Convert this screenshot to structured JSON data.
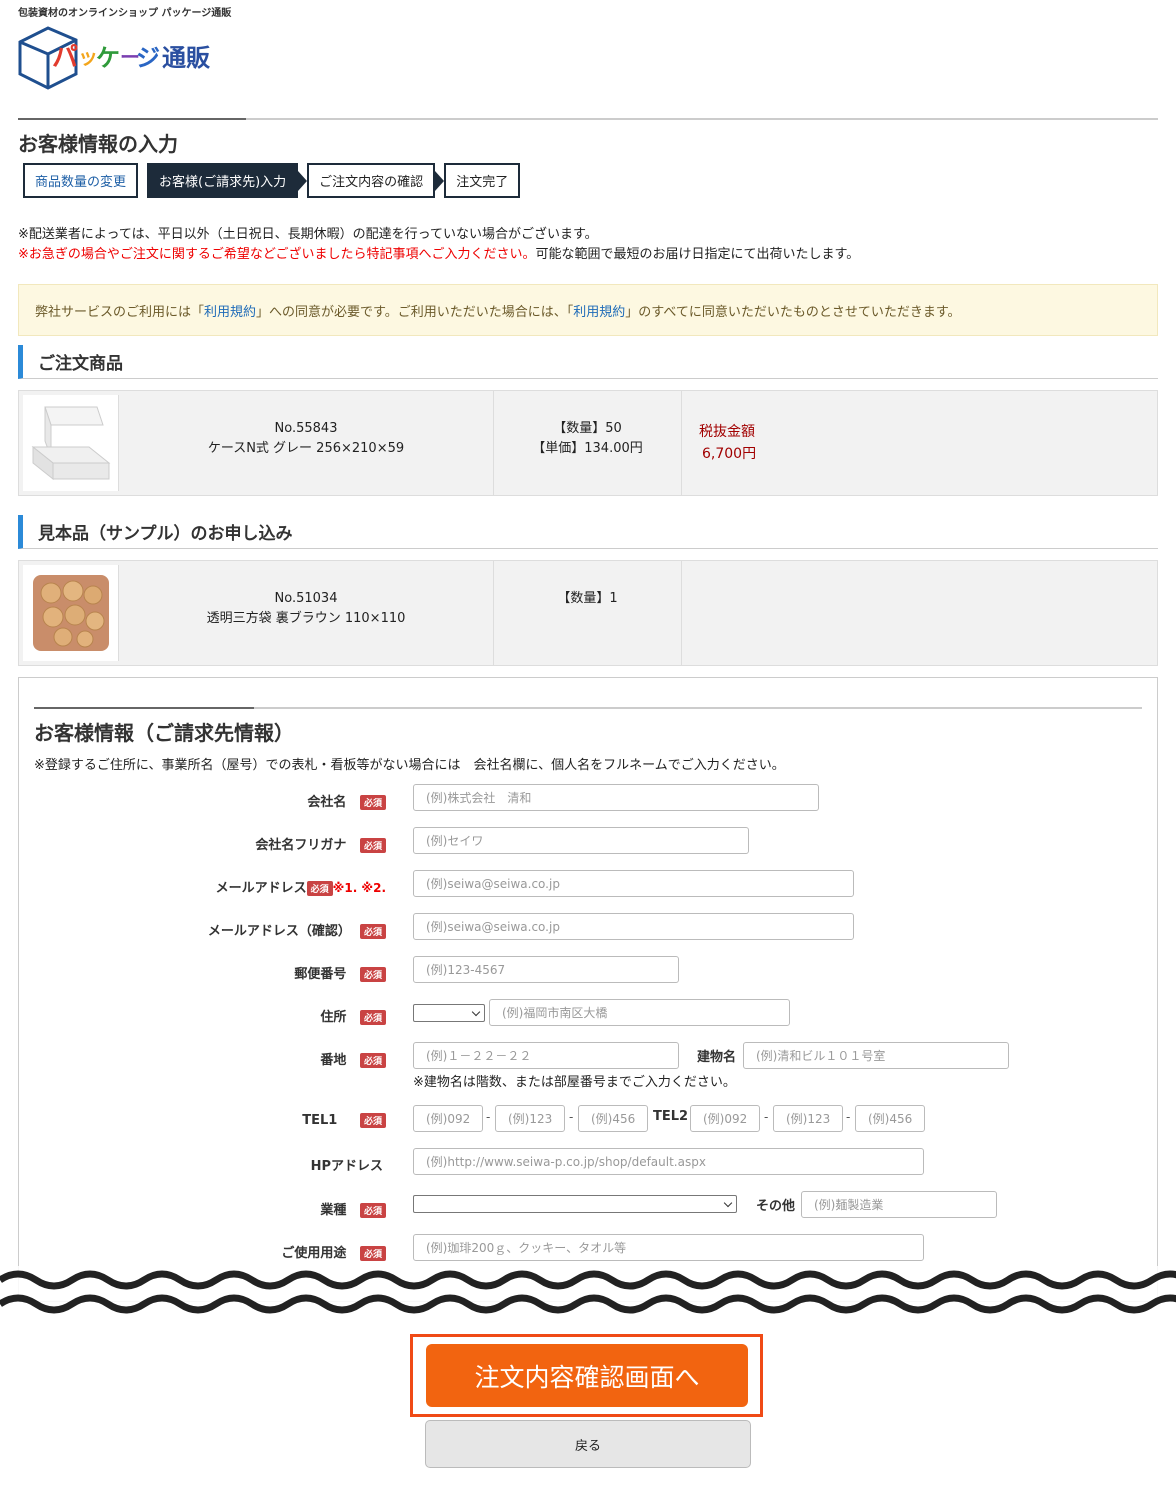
{
  "header": {
    "tagline": "包装資材のオンラインショップ パッケージ通販",
    "logo_text": "パッケージ通販"
  },
  "page_title": "お客様情報の入力",
  "steps": [
    "商品数量の変更",
    "お客様(ご請求先)入力",
    "ご注文内容の確認",
    "注文完了"
  ],
  "notes": {
    "line1": "※配送業者によっては、平日以外（土日祝日、長期休暇）の配達を行っていない場合がございます。",
    "line2_red": "※お急ぎの場合やご注文に関するご希望などございましたら特記事項へご入力ください。",
    "line2_black": "可能な範囲で最短のお届け日指定にて出荷いたします。"
  },
  "terms": {
    "t1": "弊社サービスのご利用には「",
    "link": "利用規約",
    "t2": "」への同意が必要です。ご利用いただいた場合には、「",
    "t3": "」のすべてに同意いただいたものとさせていただきます。"
  },
  "order_section": {
    "title": "ご注文商品",
    "item": {
      "no": "No.55843",
      "name": "ケースN式 グレー 256×210×59",
      "qty": "【数量】50",
      "price": "【単価】134.00円",
      "tax_label": "税抜金額",
      "amount": "6,700円"
    }
  },
  "sample_section": {
    "title": "見本品（サンプル）のお申し込み",
    "item": {
      "no": "No.51034",
      "name": "透明三方袋 裏ブラウン 110×110",
      "qty": "【数量】1"
    }
  },
  "form": {
    "title": "お客様情報（ご請求先情報）",
    "note": "※登録するご住所に、事業所名（屋号）での表札・看板等がない場合には　会社名欄に、個人名をフルネームでご入力ください。",
    "required": "必須",
    "email_note": "※1. ※2.",
    "labels": {
      "company": "会社名",
      "company_kana": "会社名フリガナ",
      "email": "メールアドレス",
      "email_confirm": "メールアドレス（確認）",
      "zip": "郵便番号",
      "address": "住所",
      "street": "番地",
      "building": "建物名",
      "tel1": "TEL1",
      "tel2": "TEL2",
      "hp": "HPアドレス",
      "industry": "業種",
      "other": "その他",
      "usage": "ご使用用途"
    },
    "placeholders": {
      "company": "(例)株式会社　清和",
      "company_kana": "(例)セイワ",
      "email": "(例)seiwa@seiwa.co.jp",
      "email_confirm": "(例)seiwa@seiwa.co.jp",
      "zip": "(例)123-4567",
      "address": "(例)福岡市南区大橋",
      "street": "(例)１－２２－２２",
      "building": "(例)清和ビル１０１号室",
      "tel_a": "(例)092",
      "tel_b": "(例)123",
      "tel_c": "(例)456",
      "hp": "(例)http://www.seiwa-p.co.jp/shop/default.aspx",
      "other": "(例)麺製造業",
      "usage": "(例)珈琲200ｇ、クッキー、タオル等"
    },
    "building_note": "※建物名は階数、または部屋番号までご入力ください。"
  },
  "buttons": {
    "confirm": "注文内容確認画面へ",
    "back": "戻る"
  },
  "colors": {
    "accent_orange": "#f26410",
    "highlight_red": "#f04a16",
    "step_navy": "#1d2b3a",
    "section_blue": "#2b8ad8"
  }
}
